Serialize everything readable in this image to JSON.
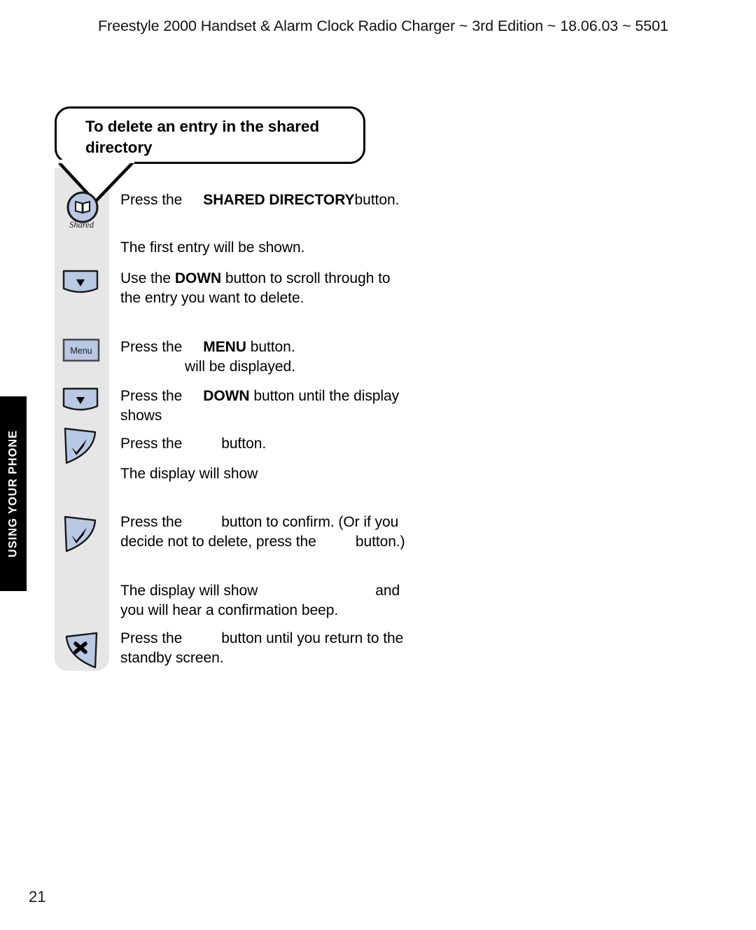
{
  "header": {
    "text": "Freestyle 2000 Handset & Alarm Clock Radio Charger  ~ 3rd Edition ~ 18.06.03 ~ 5501"
  },
  "side_tab": {
    "label": "USING YOUR PHONE"
  },
  "callout": {
    "title": "To delete an entry in the shared directory"
  },
  "page_number": "21",
  "colors": {
    "button_fill": "#b9c8e3",
    "button_stroke": "#1a1a1a",
    "icon_column_bg": "#e6e6e6",
    "tab_bg": "#000000",
    "tab_text": "#ffffff"
  },
  "steps": [
    {
      "icon": "shared-directory-button-icon",
      "icon_label": "Shared",
      "text_parts": [
        {
          "t": "Press the",
          "b": false
        },
        {
          "t": "SHARED DIRECTORY",
          "b": true
        },
        {
          "t": " button.",
          "b": false
        }
      ]
    },
    {
      "icon": "none",
      "text_parts": [
        {
          "t": "The first entry will be shown.",
          "b": false
        }
      ]
    },
    {
      "icon": "down-button-icon",
      "text_parts": [
        {
          "t": "Use the ",
          "b": false
        },
        {
          "t": "DOWN",
          "b": true
        },
        {
          "t": " button to scroll through to the entry you want to delete.",
          "b": false
        }
      ]
    },
    {
      "icon": "menu-button-icon",
      "icon_label": "Menu",
      "text_parts": [
        {
          "t": "Press the",
          "b": false
        },
        {
          "t": "MENU",
          "b": true
        },
        {
          "t": " button.",
          "b": false
        },
        {
          "t": "will be displayed.",
          "b": false
        }
      ]
    },
    {
      "icon": "down-button-icon",
      "text_parts": [
        {
          "t": "Press the",
          "b": false
        },
        {
          "t": "DOWN",
          "b": true
        },
        {
          "t": " button until the display shows",
          "b": false
        },
        {
          "t": ".",
          "b": false
        }
      ]
    },
    {
      "icon": "tick-button-icon",
      "text_parts": [
        {
          "t": "Press the",
          "b": false
        },
        {
          "t": "button.",
          "b": false
        }
      ]
    },
    {
      "icon": "none",
      "text_parts": [
        {
          "t": "The display will show",
          "b": false
        }
      ]
    },
    {
      "icon": "tick-button-icon",
      "text_parts": [
        {
          "t": "Press the",
          "b": false
        },
        {
          "t": "button to confirm. (Or if you decide not to delete, press the",
          "b": false
        },
        {
          "t": "button.)",
          "b": false
        }
      ]
    },
    {
      "icon": "none",
      "text_parts": [
        {
          "t": "The display will show",
          "b": false
        },
        {
          "t": "and you will hear a confirmation beep.",
          "b": false
        }
      ]
    },
    {
      "icon": "cancel-button-icon",
      "text_parts": [
        {
          "t": "Press the",
          "b": false
        },
        {
          "t": "button until you return to the standby screen.",
          "b": false
        }
      ]
    }
  ],
  "step_text": {
    "s1_a": "Press the",
    "s1_b": "SHARED DIRECTORY",
    "s1_c": "button.",
    "s2": "The first entry will be shown.",
    "s3_a": "Use the ",
    "s3_b": "DOWN",
    "s3_c": " button to scroll through to the entry you want to delete.",
    "s4_a": "Press the",
    "s4_b": "MENU",
    "s4_c": " button.",
    "s4_d": "will be displayed.",
    "s5_a": "Press the",
    "s5_b": "DOWN",
    "s5_c": " button until the display shows",
    "s5_d": ".",
    "s6_a": "Press the",
    "s6_b": "button.",
    "s7": "The display will show",
    "s8_a": "Press the",
    "s8_b": "button to confirm. (Or if you decide not to delete, press the",
    "s8_c": "button.)",
    "s9_a": "The display will show",
    "s9_b": "and you will hear a confirmation beep.",
    "s10_a": "Press the",
    "s10_b": "button until you return to the standby screen."
  }
}
